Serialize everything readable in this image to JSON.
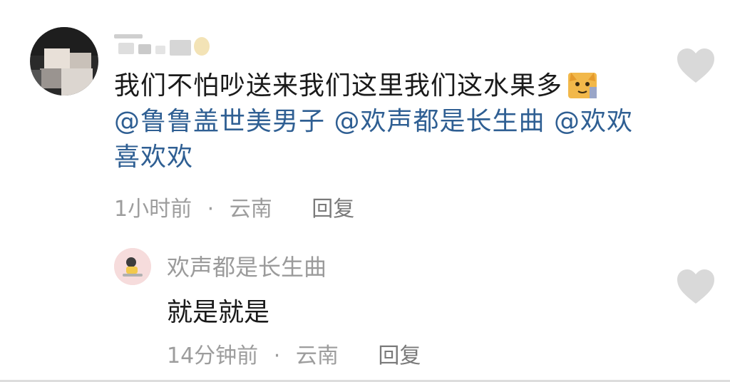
{
  "comment": {
    "text_before": "我们不怕吵送来我们这里我们这水果多",
    "emoji_icon": "cat-emoji",
    "mentions_line": [
      "@鲁鲁盖世美男子",
      "@欢声都是长生曲",
      "@欢欢喜欢欢"
    ],
    "time": "1小时前",
    "separator": "·",
    "location": "云南",
    "reply_label": "回复"
  },
  "reply": {
    "username": "欢声都是长生曲",
    "text": "就是就是",
    "time": "14分钟前",
    "separator": "·",
    "location": "云南",
    "reply_label": "回复"
  },
  "colors": {
    "mention": "#2f5f93",
    "meta": "#9d9d9d",
    "heart": "#d9d9d9"
  }
}
